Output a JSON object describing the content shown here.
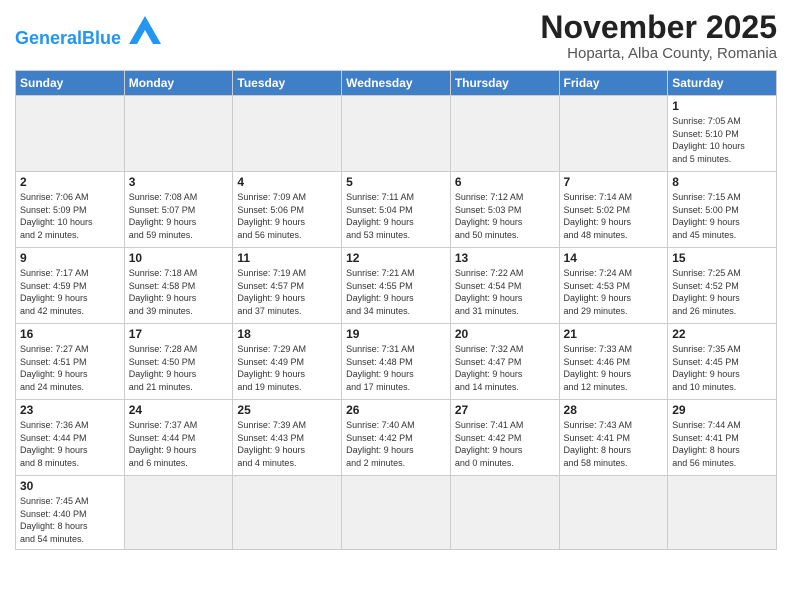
{
  "header": {
    "logo_general": "General",
    "logo_blue": "Blue",
    "month": "November 2025",
    "location": "Hoparta, Alba County, Romania"
  },
  "weekdays": [
    "Sunday",
    "Monday",
    "Tuesday",
    "Wednesday",
    "Thursday",
    "Friday",
    "Saturday"
  ],
  "weeks": [
    [
      {
        "day": "",
        "info": "",
        "empty": true
      },
      {
        "day": "",
        "info": "",
        "empty": true
      },
      {
        "day": "",
        "info": "",
        "empty": true
      },
      {
        "day": "",
        "info": "",
        "empty": true
      },
      {
        "day": "",
        "info": "",
        "empty": true
      },
      {
        "day": "",
        "info": "",
        "empty": true
      },
      {
        "day": "1",
        "info": "Sunrise: 7:05 AM\nSunset: 5:10 PM\nDaylight: 10 hours\nand 5 minutes."
      }
    ],
    [
      {
        "day": "2",
        "info": "Sunrise: 7:06 AM\nSunset: 5:09 PM\nDaylight: 10 hours\nand 2 minutes."
      },
      {
        "day": "3",
        "info": "Sunrise: 7:08 AM\nSunset: 5:07 PM\nDaylight: 9 hours\nand 59 minutes."
      },
      {
        "day": "4",
        "info": "Sunrise: 7:09 AM\nSunset: 5:06 PM\nDaylight: 9 hours\nand 56 minutes."
      },
      {
        "day": "5",
        "info": "Sunrise: 7:11 AM\nSunset: 5:04 PM\nDaylight: 9 hours\nand 53 minutes."
      },
      {
        "day": "6",
        "info": "Sunrise: 7:12 AM\nSunset: 5:03 PM\nDaylight: 9 hours\nand 50 minutes."
      },
      {
        "day": "7",
        "info": "Sunrise: 7:14 AM\nSunset: 5:02 PM\nDaylight: 9 hours\nand 48 minutes."
      },
      {
        "day": "8",
        "info": "Sunrise: 7:15 AM\nSunset: 5:00 PM\nDaylight: 9 hours\nand 45 minutes."
      }
    ],
    [
      {
        "day": "9",
        "info": "Sunrise: 7:17 AM\nSunset: 4:59 PM\nDaylight: 9 hours\nand 42 minutes."
      },
      {
        "day": "10",
        "info": "Sunrise: 7:18 AM\nSunset: 4:58 PM\nDaylight: 9 hours\nand 39 minutes."
      },
      {
        "day": "11",
        "info": "Sunrise: 7:19 AM\nSunset: 4:57 PM\nDaylight: 9 hours\nand 37 minutes."
      },
      {
        "day": "12",
        "info": "Sunrise: 7:21 AM\nSunset: 4:55 PM\nDaylight: 9 hours\nand 34 minutes."
      },
      {
        "day": "13",
        "info": "Sunrise: 7:22 AM\nSunset: 4:54 PM\nDaylight: 9 hours\nand 31 minutes."
      },
      {
        "day": "14",
        "info": "Sunrise: 7:24 AM\nSunset: 4:53 PM\nDaylight: 9 hours\nand 29 minutes."
      },
      {
        "day": "15",
        "info": "Sunrise: 7:25 AM\nSunset: 4:52 PM\nDaylight: 9 hours\nand 26 minutes."
      }
    ],
    [
      {
        "day": "16",
        "info": "Sunrise: 7:27 AM\nSunset: 4:51 PM\nDaylight: 9 hours\nand 24 minutes."
      },
      {
        "day": "17",
        "info": "Sunrise: 7:28 AM\nSunset: 4:50 PM\nDaylight: 9 hours\nand 21 minutes."
      },
      {
        "day": "18",
        "info": "Sunrise: 7:29 AM\nSunset: 4:49 PM\nDaylight: 9 hours\nand 19 minutes."
      },
      {
        "day": "19",
        "info": "Sunrise: 7:31 AM\nSunset: 4:48 PM\nDaylight: 9 hours\nand 17 minutes."
      },
      {
        "day": "20",
        "info": "Sunrise: 7:32 AM\nSunset: 4:47 PM\nDaylight: 9 hours\nand 14 minutes."
      },
      {
        "day": "21",
        "info": "Sunrise: 7:33 AM\nSunset: 4:46 PM\nDaylight: 9 hours\nand 12 minutes."
      },
      {
        "day": "22",
        "info": "Sunrise: 7:35 AM\nSunset: 4:45 PM\nDaylight: 9 hours\nand 10 minutes."
      }
    ],
    [
      {
        "day": "23",
        "info": "Sunrise: 7:36 AM\nSunset: 4:44 PM\nDaylight: 9 hours\nand 8 minutes."
      },
      {
        "day": "24",
        "info": "Sunrise: 7:37 AM\nSunset: 4:44 PM\nDaylight: 9 hours\nand 6 minutes."
      },
      {
        "day": "25",
        "info": "Sunrise: 7:39 AM\nSunset: 4:43 PM\nDaylight: 9 hours\nand 4 minutes."
      },
      {
        "day": "26",
        "info": "Sunrise: 7:40 AM\nSunset: 4:42 PM\nDaylight: 9 hours\nand 2 minutes."
      },
      {
        "day": "27",
        "info": "Sunrise: 7:41 AM\nSunset: 4:42 PM\nDaylight: 9 hours\nand 0 minutes."
      },
      {
        "day": "28",
        "info": "Sunrise: 7:43 AM\nSunset: 4:41 PM\nDaylight: 8 hours\nand 58 minutes."
      },
      {
        "day": "29",
        "info": "Sunrise: 7:44 AM\nSunset: 4:41 PM\nDaylight: 8 hours\nand 56 minutes."
      }
    ],
    [
      {
        "day": "30",
        "info": "Sunrise: 7:45 AM\nSunset: 4:40 PM\nDaylight: 8 hours\nand 54 minutes.",
        "last": true
      },
      {
        "day": "",
        "info": "",
        "empty": true,
        "last": true
      },
      {
        "day": "",
        "info": "",
        "empty": true,
        "last": true
      },
      {
        "day": "",
        "info": "",
        "empty": true,
        "last": true
      },
      {
        "day": "",
        "info": "",
        "empty": true,
        "last": true
      },
      {
        "day": "",
        "info": "",
        "empty": true,
        "last": true
      },
      {
        "day": "",
        "info": "",
        "empty": true,
        "last": true
      }
    ]
  ]
}
